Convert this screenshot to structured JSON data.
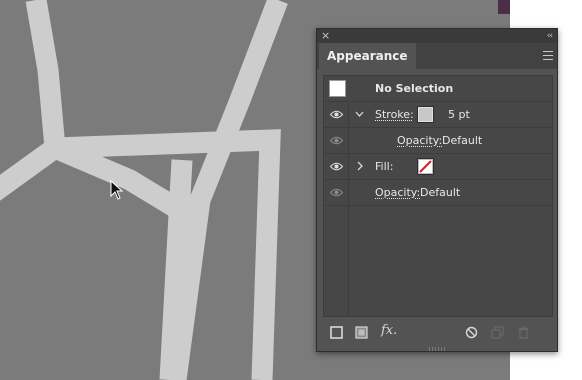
{
  "panel": {
    "tab_label": "Appearance",
    "close_glyph": "×",
    "collapse_glyph": "‹‹"
  },
  "rows": {
    "selection_label": "No Selection",
    "stroke_label": "Stroke:",
    "stroke_weight": "5 pt",
    "stroke_opacity_label": "Opacity:",
    "stroke_opacity_value": "Default",
    "fill_label": "Fill:",
    "opacity_label": "Opacity:",
    "opacity_value": "Default"
  },
  "bottom_bar": {
    "fx_label": "fx."
  },
  "colors": {
    "artboard": "#7b7b7b",
    "artwork_stroke": "#cdcdcd",
    "panel_bg": "#535353",
    "fill_none_slash": "#d0202a"
  },
  "icons": [
    "close-icon",
    "collapse-icon",
    "panel-menu-icon",
    "visibility-eye-icon",
    "chevron-down-icon",
    "chevron-right-icon",
    "add-new-stroke-icon",
    "add-new-fill-icon",
    "add-new-effect-icon",
    "clear-appearance-icon",
    "duplicate-item-icon",
    "delete-item-icon",
    "mouse-pointer-icon"
  ]
}
